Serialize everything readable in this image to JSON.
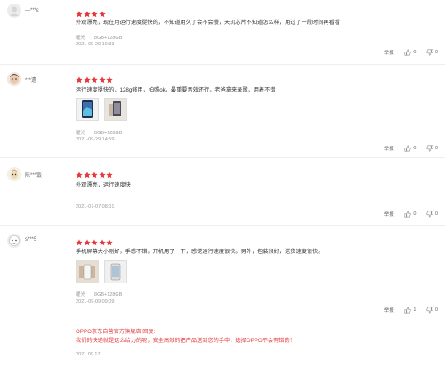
{
  "colors": {
    "star": "#e4393c",
    "reply": "#e4393c",
    "meta": "#999999"
  },
  "reviews": [
    {
      "username": "—***ε",
      "rating": 4,
      "content": "外观漂亮，现在用运行速度挺快的，不知道用久了会不会慢，天玑芯片不知道怎么样，用过了一段时间再看看",
      "color_name": "曜光",
      "spec": "8GB+128GB",
      "date": "2021-09-29 10:33",
      "report_label": "举报",
      "likes": "0",
      "dislikes": "0"
    },
    {
      "username": "***遗",
      "rating": 5,
      "content": "运行速度挺快的，128g够用，拍照ok，最重要音效还行，老爸拿来录歌，用着不错",
      "color_name": "曜光",
      "spec": "8GB+128GB",
      "date": "2021-09-29 14:59",
      "report_label": "举报",
      "likes": "0",
      "dislikes": "0"
    },
    {
      "username": "陈***饭",
      "rating": 5,
      "content": "外观漂亮，运行速度快",
      "date": "2021-07-07 08:01",
      "report_label": "举报",
      "likes": "0",
      "dislikes": "0"
    },
    {
      "username": "s***5",
      "rating": 5,
      "content": "手机屏幕大小刚好，手感不错，开机用了一下，感觉运行速度很快。另外，包装很好，送货速度很快。",
      "color_name": "曜光",
      "spec": "8GB+128GB",
      "date": "2021-09-09 09:09",
      "report_label": "举报",
      "likes": "1",
      "dislikes": "0",
      "reply": {
        "line1": "OPPO京东自营官方旗舰店 回复:",
        "line2": "我们的快递就是这么给力的呢，安全高效的把产品送到您的手中，选择OPPO不会有错的！",
        "date": "2021.09.17"
      }
    }
  ]
}
